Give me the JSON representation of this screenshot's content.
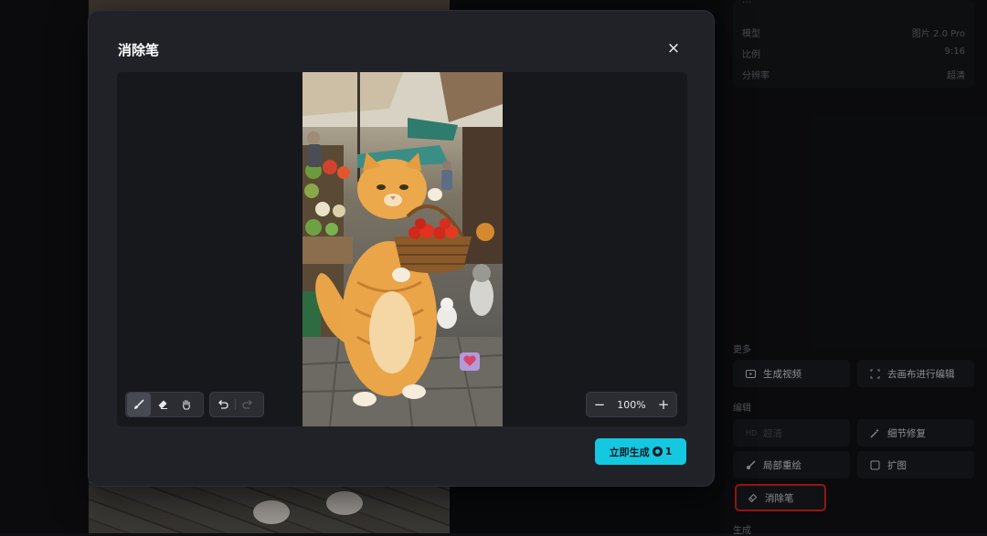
{
  "modal": {
    "title": "消除笔",
    "close_icon": "×",
    "generate_label": "立即生成",
    "generate_cost": "1"
  },
  "canvas": {
    "zoom": "100%",
    "tools": {
      "brush": "brush-icon",
      "eraser": "eraser-icon",
      "hand": "hand-icon",
      "undo": "undo-icon",
      "redo": "redo-icon",
      "zoom_out": "−",
      "zoom_in": "+"
    }
  },
  "side_panel": {
    "prompt_text": "...",
    "info": [
      {
        "label": "模型",
        "value": "图片 2.0 Pro"
      },
      {
        "label": "比例",
        "value": "9:16"
      },
      {
        "label": "分辨率",
        "value": "超清"
      }
    ],
    "sections": {
      "more": "更多",
      "edit": "编辑",
      "generate": "生成"
    },
    "buttons": {
      "gen_video": "生成视频",
      "canvas_edit": "去画布进行编辑",
      "hd": "超清",
      "detail_fix": "细节修复",
      "partial_redraw": "局部重绘",
      "expand": "扩图",
      "eraser_pen": "消除笔"
    }
  },
  "colors": {
    "accent": "#13c8e0",
    "highlight_border": "#e0261e",
    "modal_bg": "#202227"
  }
}
